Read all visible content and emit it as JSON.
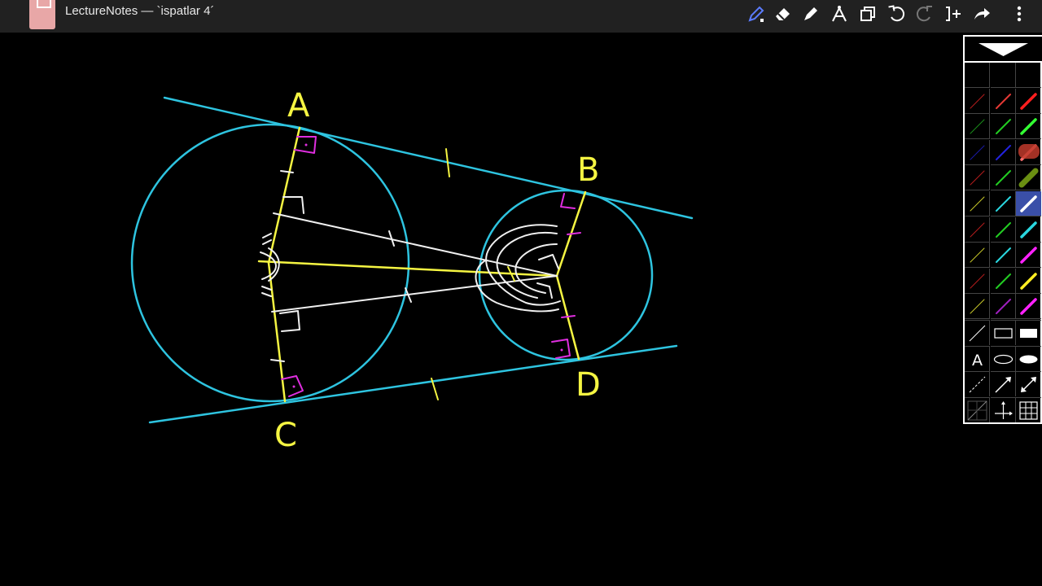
{
  "app": {
    "title": "LectureNotes — `ispatlar 4´",
    "icon": "notebook-icon"
  },
  "toolbar": {
    "tools": [
      {
        "name": "pen-icon",
        "color": "#5b7cff"
      },
      {
        "name": "eraser-icon",
        "color": "#ffffff"
      },
      {
        "name": "highlighter-icon",
        "color": "#ffffff"
      },
      {
        "name": "compass-icon",
        "color": "#ffffff"
      },
      {
        "name": "copy-icon",
        "color": "#ffffff"
      },
      {
        "name": "undo-icon",
        "color": "#ffffff"
      },
      {
        "name": "redo-icon",
        "color": "#777777"
      },
      {
        "name": "insert-page-icon",
        "color": "#ffffff"
      },
      {
        "name": "share-icon",
        "color": "#ffffff"
      },
      {
        "name": "more-vertical-icon",
        "color": "#ffffff"
      }
    ]
  },
  "drawing": {
    "labels": {
      "a": "A",
      "b": "B",
      "c": "C",
      "d": "D"
    },
    "colors": {
      "circle": "#2ec4e0",
      "tangent": "#2ec4e0",
      "radius": "#f5f542",
      "chalk": "#f0f0f0",
      "right_angle": "#e02ee0",
      "label": "#f5f542"
    }
  },
  "palette": {
    "header_icon": "collapse-triangle-icon",
    "text_tool_label": "A",
    "pen_rows": [
      [
        "#b71c1c",
        "#e53935",
        "#ff1f1f"
      ],
      [
        "#1b8f1b",
        "#22cc22",
        "#33ff33"
      ],
      [
        "#1a1aa8",
        "#2222dd",
        "#ff6f6f"
      ],
      [
        "#b71c1c",
        "#22cc22",
        "#6a8f12"
      ],
      [
        "#c9c92a",
        "#2ad7e0",
        "#ffffff"
      ],
      [
        "#b71c1c",
        "#22cc22",
        "#2ad7e0"
      ],
      [
        "#c9c92a",
        "#2ad7e0",
        "#ff22ff"
      ],
      [
        "#b71c1c",
        "#22cc22",
        "#ffee22"
      ],
      [
        "#c9c92a",
        "#9f1fbf",
        "#ff22ff"
      ]
    ],
    "shape_tools": [
      "line-tool-icon",
      "rectangle-tool-icon",
      "filled-rectangle-tool-icon",
      "text-tool-icon",
      "ellipse-tool-icon",
      "filled-ellipse-tool-icon",
      "dashed-line-tool-icon",
      "arrow-tool-icon",
      "double-arrow-tool-icon",
      "grid-diagonal-icon",
      "axes-icon",
      "grid-icon"
    ],
    "selected_highlight": "#3a4fa8",
    "badge_color": "#c0392b"
  }
}
